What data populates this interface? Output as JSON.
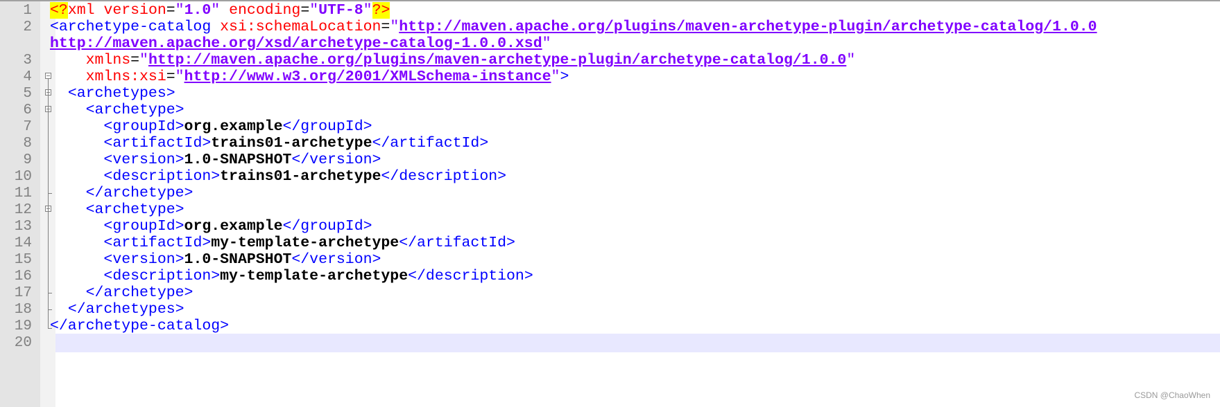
{
  "line_numbers": [
    "1",
    "2",
    "",
    "3",
    "4",
    "5",
    "6",
    "7",
    "8",
    "9",
    "10",
    "11",
    "12",
    "13",
    "14",
    "15",
    "16",
    "17",
    "18",
    "19",
    "20"
  ],
  "code": {
    "xml_decl": {
      "open": "<?",
      "name": "xml",
      "attr1": "version",
      "val1": "1.0",
      "attr2": "encoding",
      "val2": "UTF-8",
      "close": "?>"
    },
    "catalog_open": "<archetype-catalog",
    "schema_attr": "xsi:schemaLocation",
    "schema_url1": "http://maven.apache.org/plugins/maven-archetype-plugin/archetype-catalog/1.0.0",
    "schema_url2": "http://maven.apache.org/xsd/archetype-catalog-1.0.0.xsd",
    "xmlns_attr": "xmlns",
    "xmlns_url": "http://maven.apache.org/plugins/maven-archetype-plugin/archetype-catalog/1.0.0",
    "xsi_attr": "xmlns:xsi",
    "xsi_url": "http://www.w3.org/2001/XMLSchema-instance",
    "archetypes_open": "<archetypes>",
    "archetypes_close": "</archetypes>",
    "catalog_close": "</archetype-catalog>",
    "archetype_open": "<archetype>",
    "archetype_close": "</archetype>",
    "archetypes": [
      {
        "groupId": "org.example",
        "artifactId": "trains01-archetype",
        "version": "1.0-SNAPSHOT",
        "description": "trains01-archetype"
      },
      {
        "groupId": "org.example",
        "artifactId": "my-template-archetype",
        "version": "1.0-SNAPSHOT",
        "description": "my-template-archetype"
      }
    ],
    "tags": {
      "groupId_open": "<groupId>",
      "groupId_close": "</groupId>",
      "artifactId_open": "<artifactId>",
      "artifactId_close": "</artifactId>",
      "version_open": "<version>",
      "version_close": "</version>",
      "description_open": "<description>",
      "description_close": "</description>"
    }
  },
  "watermark": "CSDN @ChaoWhen"
}
